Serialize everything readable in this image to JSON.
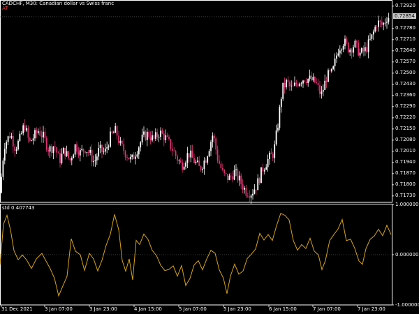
{
  "header": {
    "title": "CADCHF, M30:  Canadian dollar vs Swiss franc",
    "algo_label": "AT"
  },
  "price_axis": {
    "labels": [
      "0.72920",
      "0.72780",
      "0.72710",
      "0.72640",
      "0.72570",
      "0.72500",
      "0.72430",
      "0.72360",
      "0.72290",
      "0.72220",
      "0.72150",
      "0.72080",
      "0.72010",
      "0.71940",
      "0.71870",
      "0.71800",
      "0.71730"
    ],
    "current_price": "0.72854"
  },
  "indicator": {
    "label": "std 0.407743",
    "levels": [
      "1.000000",
      "0.000000",
      "-1.000000"
    ]
  },
  "time_axis": {
    "labels": [
      "31 Dec 2021",
      "3 Jan 07:00",
      "3 Jan 23:00",
      "4 Jan 15:00",
      "5 Jan 07:00",
      "5 Jan 23:00",
      "6 Jan 15:00",
      "7 Jan 07:00",
      "7 Jan 23:00"
    ]
  },
  "colors": {
    "background": "#000000",
    "grid": "#ffffff",
    "bull_candle": "#ffffff",
    "bear_candle": "#d8326e",
    "indicator_line": "#d9a514",
    "zero_line": "#777777"
  },
  "chart_data": [
    {
      "type": "candlestick",
      "title": "CADCHF, M30:  Canadian dollar vs Swiss franc",
      "ylim": [
        0.7169,
        0.7295
      ],
      "anchors": [
        [
          0,
          0.7175
        ],
        [
          6,
          0.7205
        ],
        [
          15,
          0.7212
        ],
        [
          22,
          0.7203
        ],
        [
          28,
          0.7208
        ],
        [
          35,
          0.7218
        ],
        [
          42,
          0.7206
        ],
        [
          48,
          0.721
        ],
        [
          55,
          0.7214
        ],
        [
          62,
          0.721
        ],
        [
          70,
          0.7202
        ],
        [
          78,
          0.7205
        ],
        [
          85,
          0.7195
        ],
        [
          92,
          0.7202
        ],
        [
          100,
          0.7195
        ],
        [
          108,
          0.7205
        ],
        [
          115,
          0.72
        ],
        [
          122,
          0.7203
        ],
        [
          128,
          0.72
        ],
        [
          135,
          0.7194
        ],
        [
          142,
          0.7202
        ],
        [
          150,
          0.72
        ],
        [
          158,
          0.721
        ],
        [
          166,
          0.7214
        ],
        [
          172,
          0.7205
        ],
        [
          180,
          0.72
        ],
        [
          188,
          0.7195
        ],
        [
          196,
          0.7202
        ],
        [
          205,
          0.721
        ],
        [
          212,
          0.7212
        ],
        [
          220,
          0.7208
        ],
        [
          228,
          0.7213
        ],
        [
          236,
          0.721
        ],
        [
          245,
          0.7204
        ],
        [
          252,
          0.7198
        ],
        [
          260,
          0.7192
        ],
        [
          270,
          0.72
        ],
        [
          278,
          0.7195
        ],
        [
          286,
          0.719
        ],
        [
          295,
          0.7197
        ],
        [
          305,
          0.7212
        ],
        [
          312,
          0.7196
        ],
        [
          320,
          0.7186
        ],
        [
          328,
          0.7184
        ],
        [
          336,
          0.7188
        ],
        [
          344,
          0.7182
        ],
        [
          352,
          0.7176
        ],
        [
          360,
          0.7175
        ],
        [
          368,
          0.718
        ],
        [
          376,
          0.719
        ],
        [
          384,
          0.7196
        ],
        [
          392,
          0.72
        ],
        [
          398,
          0.7218
        ],
        [
          404,
          0.724
        ],
        [
          410,
          0.7244
        ],
        [
          418,
          0.724
        ],
        [
          428,
          0.7245
        ],
        [
          436,
          0.7247
        ],
        [
          444,
          0.7246
        ],
        [
          452,
          0.7244
        ],
        [
          460,
          0.7236
        ],
        [
          468,
          0.7248
        ],
        [
          476,
          0.725
        ],
        [
          484,
          0.7265
        ],
        [
          492,
          0.727
        ],
        [
          500,
          0.7265
        ],
        [
          508,
          0.7268
        ],
        [
          516,
          0.7262
        ],
        [
          524,
          0.7265
        ],
        [
          532,
          0.7272
        ],
        [
          540,
          0.7282
        ],
        [
          548,
          0.728
        ],
        [
          554,
          0.7285
        ],
        [
          558,
          0.72854
        ]
      ]
    },
    {
      "type": "line",
      "title": "std 0.407743",
      "ylim": [
        -1.0,
        1.0
      ],
      "anchors": [
        [
          0,
          -0.2
        ],
        [
          5,
          0.6
        ],
        [
          10,
          0.8
        ],
        [
          15,
          0.5
        ],
        [
          20,
          0.1
        ],
        [
          26,
          -0.1
        ],
        [
          32,
          0.0
        ],
        [
          38,
          -0.1
        ],
        [
          45,
          -0.3
        ],
        [
          52,
          -0.1
        ],
        [
          60,
          0.0
        ],
        [
          66,
          -0.1
        ],
        [
          72,
          -0.3
        ],
        [
          78,
          -0.5
        ],
        [
          84,
          -0.8
        ],
        [
          90,
          -0.6
        ],
        [
          96,
          -0.4
        ],
        [
          102,
          0.3
        ],
        [
          108,
          0.1
        ],
        [
          115,
          0.0
        ],
        [
          121,
          -0.3
        ],
        [
          128,
          0.0
        ],
        [
          134,
          -0.1
        ],
        [
          140,
          -0.3
        ],
        [
          146,
          -0.1
        ],
        [
          152,
          0.2
        ],
        [
          158,
          0.4
        ],
        [
          164,
          0.8
        ],
        [
          170,
          0.5
        ],
        [
          175,
          -0.1
        ],
        [
          180,
          -0.3
        ],
        [
          185,
          -0.1
        ],
        [
          190,
          -0.5
        ],
        [
          195,
          0.3
        ],
        [
          200,
          0.2
        ],
        [
          206,
          0.4
        ],
        [
          212,
          0.3
        ],
        [
          218,
          0.1
        ],
        [
          224,
          0.0
        ],
        [
          230,
          -0.2
        ],
        [
          236,
          -0.3
        ],
        [
          242,
          -0.3
        ],
        [
          248,
          -0.2
        ],
        [
          254,
          -0.4
        ],
        [
          260,
          -0.2
        ],
        [
          266,
          -0.6
        ],
        [
          272,
          -0.5
        ],
        [
          278,
          -0.2
        ],
        [
          284,
          -0.1
        ],
        [
          290,
          -0.3
        ],
        [
          296,
          -0.1
        ],
        [
          302,
          0.1
        ],
        [
          308,
          0.0
        ],
        [
          314,
          -0.3
        ],
        [
          320,
          -0.5
        ],
        [
          325,
          -0.8
        ],
        [
          330,
          -0.4
        ],
        [
          336,
          -0.2
        ],
        [
          342,
          -0.4
        ],
        [
          348,
          -0.3
        ],
        [
          354,
          -0.1
        ],
        [
          360,
          0.0
        ],
        [
          366,
          0.1
        ],
        [
          372,
          0.4
        ],
        [
          378,
          0.3
        ],
        [
          384,
          0.4
        ],
        [
          390,
          0.3
        ],
        [
          396,
          0.6
        ],
        [
          402,
          0.8
        ],
        [
          408,
          0.8
        ],
        [
          414,
          0.7
        ],
        [
          420,
          0.3
        ],
        [
          426,
          0.1
        ],
        [
          432,
          0.2
        ],
        [
          438,
          0.1
        ],
        [
          444,
          0.3
        ],
        [
          450,
          0.1
        ],
        [
          456,
          0.0
        ],
        [
          461,
          -0.3
        ],
        [
          466,
          -0.1
        ],
        [
          472,
          0.3
        ],
        [
          478,
          0.4
        ],
        [
          484,
          0.5
        ],
        [
          490,
          0.7
        ],
        [
          496,
          0.3
        ],
        [
          502,
          0.3
        ],
        [
          508,
          0.1
        ],
        [
          514,
          -0.1
        ],
        [
          519,
          -0.2
        ],
        [
          524,
          0.1
        ],
        [
          530,
          0.3
        ],
        [
          536,
          0.4
        ],
        [
          542,
          0.5
        ],
        [
          548,
          0.4
        ],
        [
          554,
          0.6
        ],
        [
          560,
          0.4
        ]
      ]
    }
  ]
}
